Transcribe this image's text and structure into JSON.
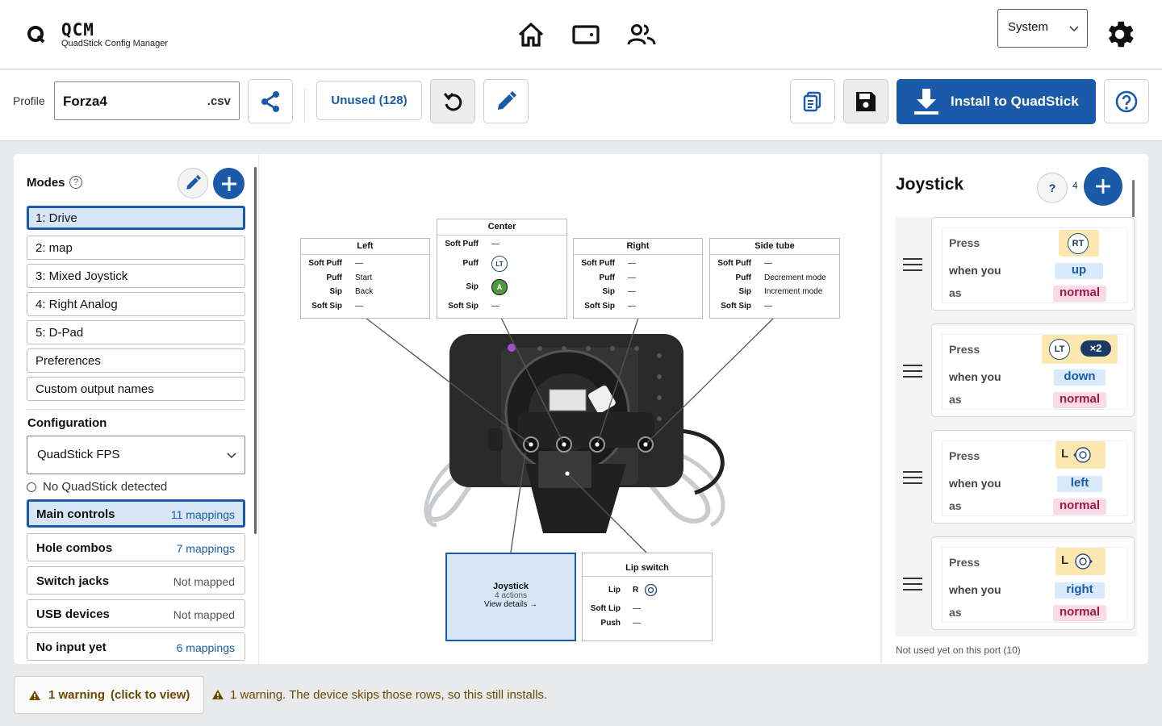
{
  "app": {
    "title": "QCM",
    "subtitle": "QuadStick Config Manager",
    "theme_select": "System"
  },
  "toolbar": {
    "profile_label": "Profile",
    "profile_name": "Forza4",
    "profile_ext": ".csv",
    "unused_label": "Unused (128)",
    "install_label": "Install to QuadStick"
  },
  "modes": {
    "title": "Modes",
    "items": [
      "1: Drive",
      "2: map",
      "3: Mixed Joystick",
      "4: Right Analog",
      "5: D-Pad",
      "Preferences",
      "Custom output names"
    ]
  },
  "configuration": {
    "title": "Configuration",
    "select": "QuadStick FPS",
    "status": "No QuadStick detected",
    "groups": [
      {
        "name": "Main controls",
        "count": "11 mappings"
      },
      {
        "name": "Hole combos",
        "count": "7 mappings"
      },
      {
        "name": "Switch jacks",
        "count": "Not mapped"
      },
      {
        "name": "USB devices",
        "count": "Not mapped"
      },
      {
        "name": "No input yet",
        "count": "6 mappings"
      }
    ]
  },
  "diagram": {
    "left": {
      "title": "Left",
      "rows": [
        [
          "Soft Puff",
          "—"
        ],
        [
          "Puff",
          "Start"
        ],
        [
          "Sip",
          "Back"
        ],
        [
          "Soft Sip",
          "—"
        ]
      ]
    },
    "center": {
      "title": "Center",
      "rows": [
        [
          "Soft Puff",
          "—"
        ],
        [
          "Puff",
          "LT"
        ],
        [
          "Sip",
          "A"
        ],
        [
          "Soft Sip",
          "—"
        ]
      ]
    },
    "right": {
      "title": "Right",
      "rows": [
        [
          "Soft Puff",
          "—"
        ],
        [
          "Puff",
          "—"
        ],
        [
          "Sip",
          "—"
        ],
        [
          "Soft Sip",
          "—"
        ]
      ]
    },
    "side": {
      "title": "Side tube",
      "rows": [
        [
          "Soft Puff",
          "—"
        ],
        [
          "Puff",
          "Decrement mode"
        ],
        [
          "Sip",
          "Increment mode"
        ],
        [
          "Soft Sip",
          "—"
        ]
      ]
    },
    "joystick": {
      "title": "Joystick",
      "actions": "4 actions",
      "details": "View details →"
    },
    "lip": {
      "title": "Lip switch",
      "rows": [
        [
          "Lip",
          "R"
        ],
        [
          "Soft Lip",
          "—"
        ],
        [
          "Push",
          "—"
        ]
      ]
    }
  },
  "panel": {
    "title": "Joystick",
    "help": "?",
    "count": "4",
    "labels": {
      "press": "Press",
      "when": "when you",
      "as": "as"
    },
    "mappings": [
      {
        "button": "RT",
        "direction": "up",
        "mode": "normal"
      },
      {
        "button": "LT",
        "badge": "×2",
        "direction": "down",
        "mode": "normal"
      },
      {
        "button": "L",
        "direction": "left",
        "mode": "normal"
      },
      {
        "button": "L",
        "direction": "right",
        "mode": "normal"
      }
    ],
    "footer": "Not used yet on this port (10)"
  },
  "status": {
    "warn_button": "1 warning",
    "warn_click": "(click to view)",
    "warn_text": "1 warning. The device skips those rows, so this still installs."
  },
  "colors": {
    "accent": "#1a5aa8",
    "selected_bg": "#d6e6f6",
    "chip": "#fde7b0",
    "warning": "#6b4a00"
  }
}
